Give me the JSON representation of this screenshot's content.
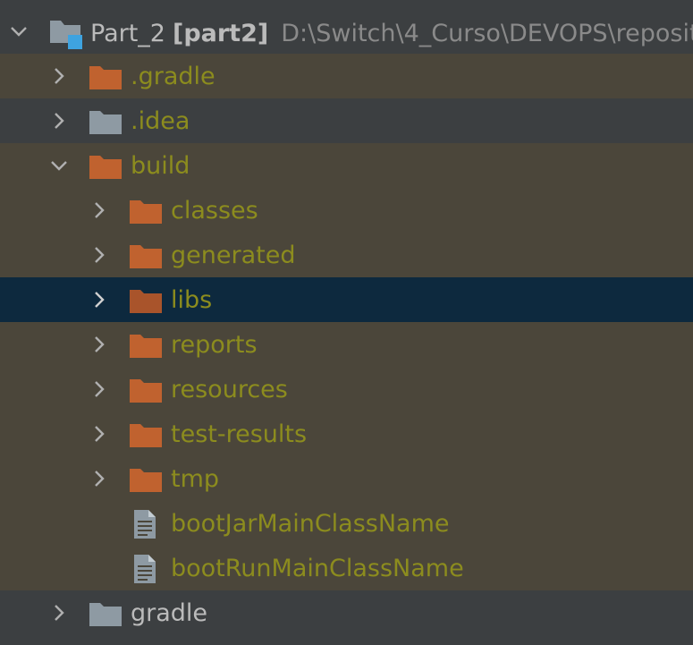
{
  "colors": {
    "background_dark": "#3c3f41",
    "background_olive": "#4b463a",
    "selection": "#0d293e",
    "label_ignored": "#8c8c1e",
    "label_normal": "#bbbbbb",
    "folder_excluded": "#c0622f",
    "folder_normal": "#8e9aa3"
  },
  "root": {
    "name": "Part_2",
    "module": "[part2]",
    "path": "D:\\Switch\\4_Curso\\DEVOPS\\reposito",
    "icon": "module-folder-icon",
    "expanded": true
  },
  "items": [
    {
      "label": ".gradle",
      "icon": "folder-excluded-icon",
      "expanded": false
    },
    {
      "label": ".idea",
      "icon": "folder-icon",
      "expanded": false
    },
    {
      "label": "build",
      "icon": "folder-excluded-icon",
      "expanded": true
    },
    {
      "label": "classes",
      "icon": "folder-excluded-icon",
      "expanded": false
    },
    {
      "label": "generated",
      "icon": "folder-excluded-icon",
      "expanded": false
    },
    {
      "label": "libs",
      "icon": "folder-excluded-icon",
      "expanded": false,
      "selected": true
    },
    {
      "label": "reports",
      "icon": "folder-excluded-icon",
      "expanded": false
    },
    {
      "label": "resources",
      "icon": "folder-excluded-icon",
      "expanded": false
    },
    {
      "label": "test-results",
      "icon": "folder-excluded-icon",
      "expanded": false
    },
    {
      "label": "tmp",
      "icon": "folder-excluded-icon",
      "expanded": false
    },
    {
      "label": "bootJarMainClassName",
      "icon": "text-file-icon"
    },
    {
      "label": "bootRunMainClassName",
      "icon": "text-file-icon"
    },
    {
      "label": "gradle",
      "icon": "folder-icon",
      "expanded": false
    }
  ]
}
